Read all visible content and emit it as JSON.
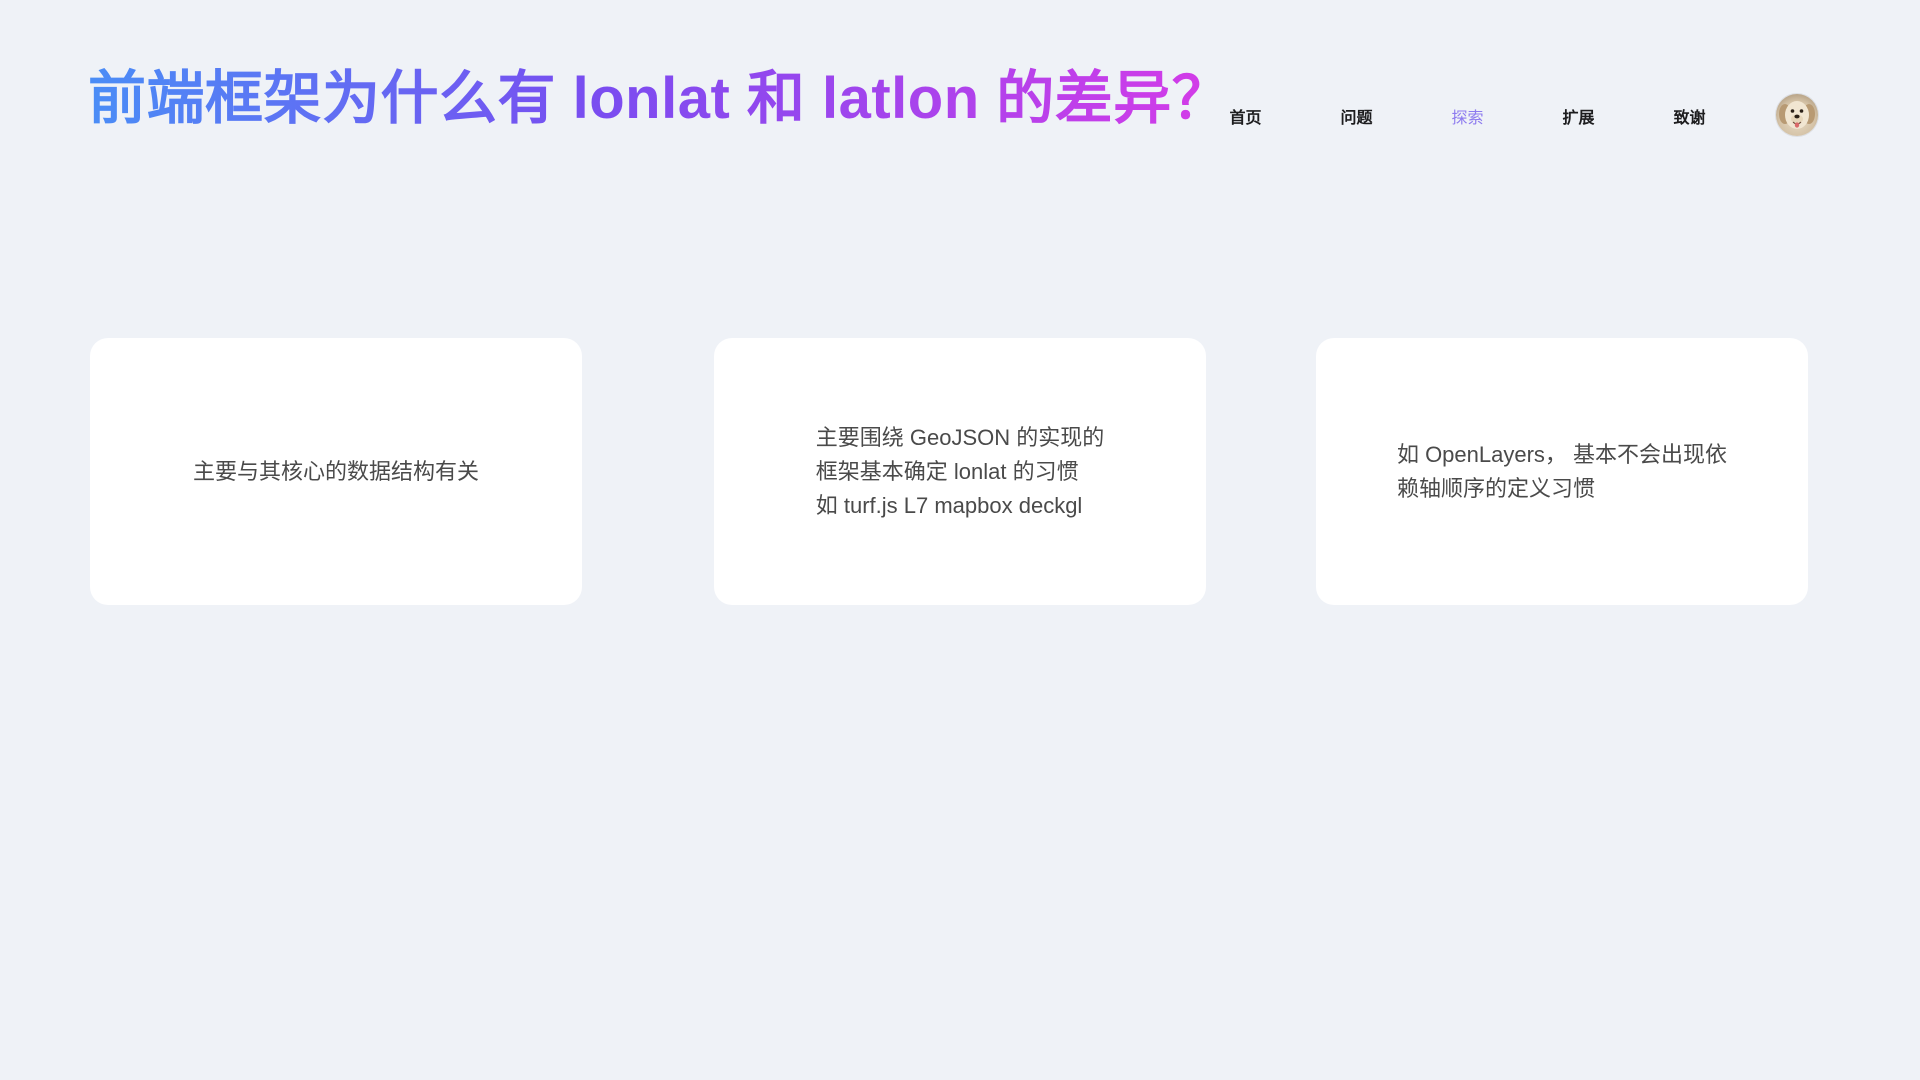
{
  "header": {
    "title": "前端框架为什么有 lonlat 和 latlon 的差异？"
  },
  "nav": {
    "items": [
      {
        "label": "首页",
        "active": false
      },
      {
        "label": "问题",
        "active": false
      },
      {
        "label": "探索",
        "active": true
      },
      {
        "label": "扩展",
        "active": false
      },
      {
        "label": "致谢",
        "active": false
      }
    ],
    "avatar_icon": "dog-avatar-icon"
  },
  "cards": [
    {
      "lines": [
        "主要与其核心的数据结构有关"
      ]
    },
    {
      "lines": [
        "主要围绕 GeoJSON 的实现的",
        "框架基本确定 lonlat 的习惯",
        "如 turf.js L7 mapbox deckgl"
      ]
    },
    {
      "lines": [
        "如 OpenLayers， 基本不会出现依",
        "赖轴顺序的定义习惯"
      ]
    }
  ],
  "colors": {
    "background": "#EFF2F7",
    "title_gradient_start": "#4A8DF6",
    "title_gradient_mid": "#7A4CF0",
    "title_gradient_end": "#D63BE8",
    "nav_active": "#8D7BEF",
    "card_background": "#FFFFFF",
    "card_text": "#4A4A4A"
  }
}
